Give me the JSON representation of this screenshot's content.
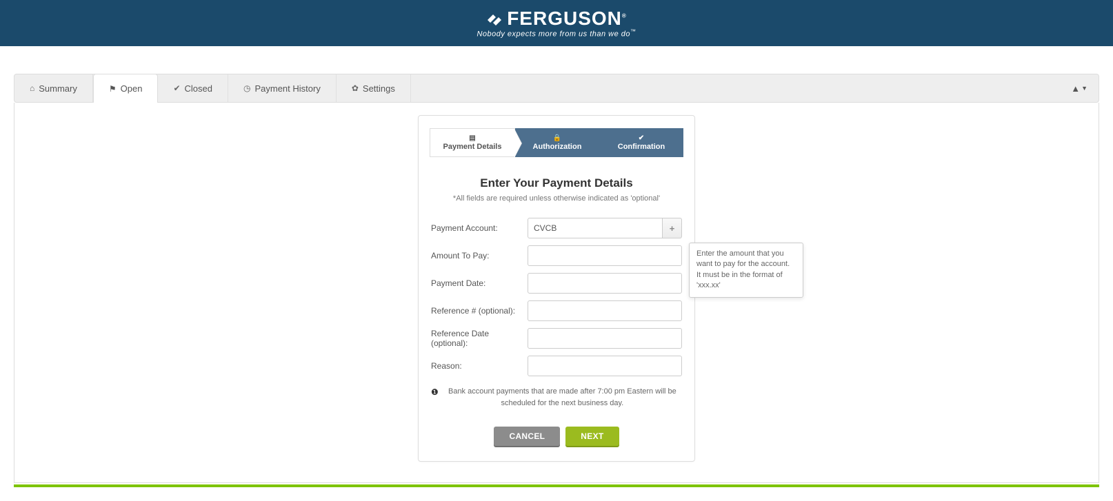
{
  "brand": {
    "name": "FERGUSON",
    "reg": "®",
    "tag_prefix": "Nobody expects more from us than we do",
    "tag_tm": "™"
  },
  "tabs": {
    "summary": "Summary",
    "open": "Open",
    "closed": "Closed",
    "history": "Payment History",
    "settings": "Settings"
  },
  "wizard": {
    "step1": "Payment Details",
    "step2": "Authorization",
    "step3": "Confirmation"
  },
  "form": {
    "heading": "Enter Your Payment Details",
    "required_note": "*All fields are required unless otherwise indicated as 'optional'",
    "labels": {
      "payment_account": "Payment Account:",
      "amount": "Amount To Pay:",
      "date": "Payment Date:",
      "reference_num": "Reference # (optional):",
      "reference_date": "Reference Date (optional):",
      "reason": "Reason:"
    },
    "values": {
      "payment_account": "CVCB",
      "amount": "",
      "date": "",
      "reference_num": "",
      "reference_date": "",
      "reason": ""
    },
    "tooltip_amount": "Enter the amount that you want to pay for the account. It must be in the format of 'xxx.xx'",
    "notice": "Bank account payments that are made after 7:00 pm Eastern will be scheduled for the next business day."
  },
  "buttons": {
    "cancel": "CANCEL",
    "next": "NEXT"
  }
}
